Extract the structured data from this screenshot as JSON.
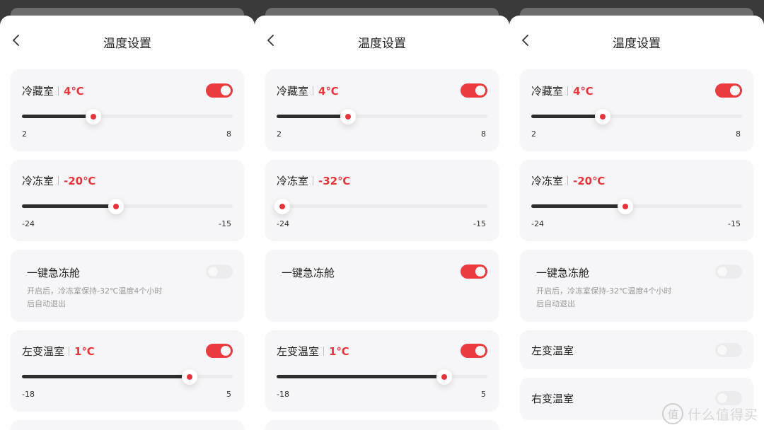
{
  "title": "温度设置",
  "back_icon": "chevron-left-icon",
  "colors": {
    "accent": "#ea3b3e",
    "temp_text": "#e5353a",
    "card_bg": "#f6f6f8",
    "track_fill": "#2d2d2d"
  },
  "panels": [
    {
      "fridge": {
        "label": "冷藏室",
        "temp": "4℃",
        "min": "2",
        "max": "8",
        "value": 4,
        "enabled": true
      },
      "freezer": {
        "label": "冷冻室",
        "temp": "-20℃",
        "min": "-24",
        "max": "-15",
        "value": -20
      },
      "quick_freeze": {
        "label": "一键急冻舱",
        "desc_line1": "开启后，冷冻室保持-32℃温度4个小时",
        "desc_line2": "后自动退出",
        "enabled": false
      },
      "left_var": {
        "label": "左变温室",
        "temp": "1℃",
        "min": "-18",
        "max": "5",
        "value": 1,
        "enabled": true
      }
    },
    {
      "fridge": {
        "label": "冷藏室",
        "temp": "4℃",
        "min": "2",
        "max": "8",
        "value": 4,
        "enabled": true
      },
      "freezer": {
        "label": "冷冻室",
        "temp": "-32℃",
        "min": "-24",
        "max": "-15",
        "value": -24
      },
      "quick_freeze": {
        "label": "一键急冻舱",
        "enabled": true
      },
      "left_var": {
        "label": "左变温室",
        "temp": "1℃",
        "min": "-18",
        "max": "5",
        "value": 1,
        "enabled": true
      }
    },
    {
      "fridge": {
        "label": "冷藏室",
        "temp": "4℃",
        "min": "2",
        "max": "8",
        "value": 4,
        "enabled": true
      },
      "freezer": {
        "label": "冷冻室",
        "temp": "-20℃",
        "min": "-24",
        "max": "-15",
        "value": -20
      },
      "quick_freeze": {
        "label": "一键急冻舱",
        "desc_line1": "开启后，冷冻室保持-32℃温度4个小时",
        "desc_line2": "后自动退出",
        "enabled": false
      },
      "left_var": {
        "label": "左变温室",
        "enabled": false
      },
      "right_var": {
        "label": "右变温室",
        "enabled": false
      }
    }
  ],
  "watermark": {
    "logo": "值",
    "text": "什么值得买"
  }
}
